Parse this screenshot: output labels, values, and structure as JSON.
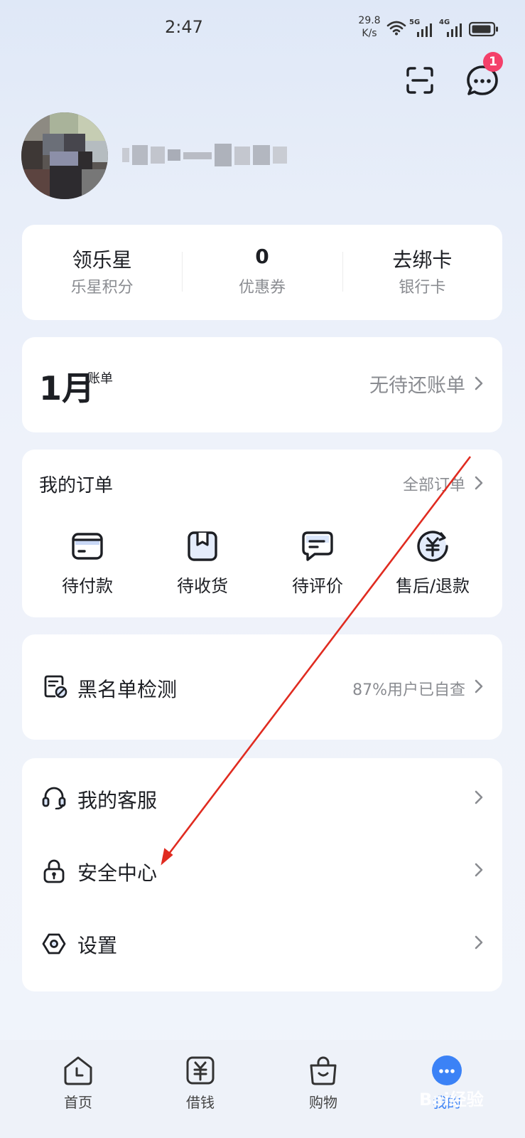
{
  "status_bar": {
    "time": "2:47",
    "net_speed_value": "29.8",
    "net_speed_unit": "K/s",
    "sim1": "5G",
    "sim2": "4G"
  },
  "header": {
    "message_badge": "1"
  },
  "stats": [
    {
      "value": "领乐星",
      "label": "乐星积分"
    },
    {
      "value": "0",
      "label": "优惠券"
    },
    {
      "value": "去绑卡",
      "label": "银行卡"
    }
  ],
  "bill": {
    "month": "1月",
    "sub": "账单",
    "status": "无待还账单"
  },
  "orders": {
    "title": "我的订单",
    "all": "全部订单",
    "items": [
      {
        "label": "待付款",
        "icon": "wallet-card-icon"
      },
      {
        "label": "待收货",
        "icon": "package-box-icon"
      },
      {
        "label": "待评价",
        "icon": "comment-icon"
      },
      {
        "label": "售后/退款",
        "icon": "refund-yuan-icon"
      }
    ]
  },
  "blacklist": {
    "label": "黑名单检测",
    "hint": "87%用户已自查"
  },
  "menu": [
    {
      "label": "我的客服",
      "icon": "headset-icon"
    },
    {
      "label": "安全中心",
      "icon": "lock-icon"
    },
    {
      "label": "设置",
      "icon": "settings-hexagon-icon"
    }
  ],
  "tabs": [
    {
      "label": "首页",
      "icon": "home-clock-icon"
    },
    {
      "label": "借钱",
      "icon": "loan-yuan-icon"
    },
    {
      "label": "购物",
      "icon": "shopping-bag-icon"
    },
    {
      "label": "我的",
      "icon": "profile-dots-icon"
    }
  ],
  "watermark": "Bai经验",
  "colors": {
    "accent": "#3b82f6",
    "badge": "#f4406a",
    "arrow": "#e02b20",
    "muted_text": "#8a8c91"
  }
}
